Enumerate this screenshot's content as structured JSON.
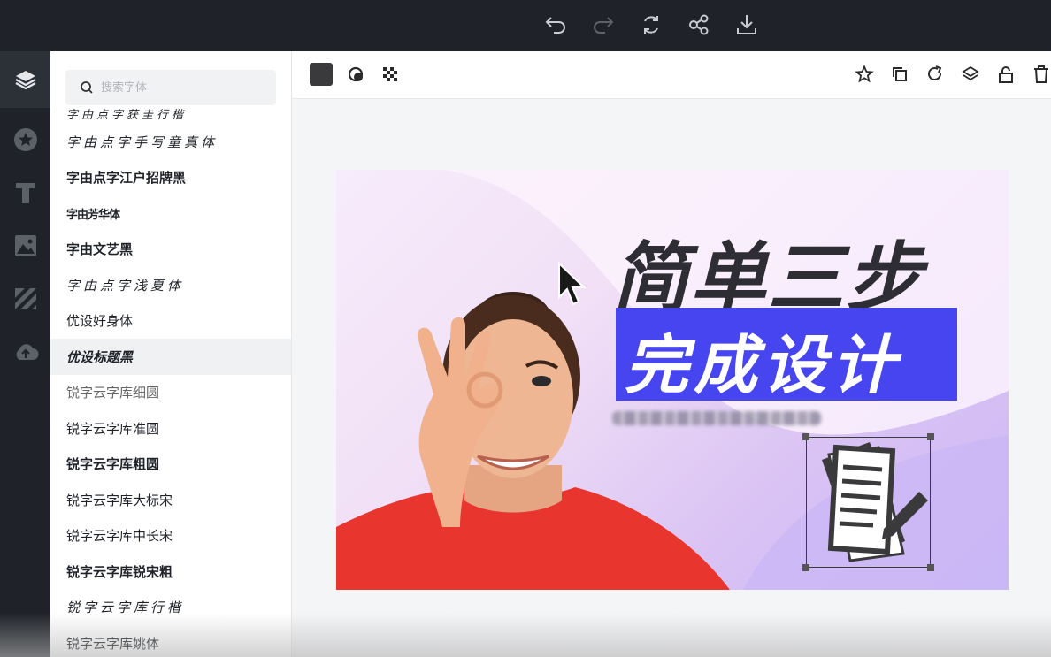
{
  "top_actions": [
    "undo-icon",
    "redo-icon",
    "refresh-icon",
    "share-icon",
    "download-icon"
  ],
  "rail": [
    "layers-icon",
    "star-icon",
    "text-icon",
    "image-icon",
    "background-icon",
    "upload-icon"
  ],
  "search": {
    "placeholder": "搜索字体"
  },
  "fonts": [
    {
      "label": "字由点字获圭行楷",
      "style": "partial"
    },
    {
      "label": "字由点字手写童真体",
      "style": "script"
    },
    {
      "label": "字由点字江户招牌黑",
      "style": "bold"
    },
    {
      "label": "字由芳华体",
      "style": "small"
    },
    {
      "label": "字由文艺黑",
      "style": "bold"
    },
    {
      "label": "字由点字浅夏体",
      "style": "script"
    },
    {
      "label": "优设好身体",
      "style": "plain"
    },
    {
      "label": "优设标题黑",
      "style": "italicbold",
      "highlighted": true
    },
    {
      "label": "锐字云字库细圆",
      "style": "light"
    },
    {
      "label": "锐字云字库准圆",
      "style": "plain"
    },
    {
      "label": "锐字云字库粗圆",
      "style": "bold"
    },
    {
      "label": "锐字云字库大标宋",
      "style": "serif"
    },
    {
      "label": "锐字云字库中长宋",
      "style": "serif"
    },
    {
      "label": "锐字云字库锐宋粗",
      "style": "bold"
    },
    {
      "label": "锐字云字库行楷",
      "style": "script"
    },
    {
      "label": "锐字云字库姚体",
      "style": "plain"
    }
  ],
  "toolbar": {
    "left": [
      "color-swatch",
      "shape-icon",
      "transparency-icon"
    ],
    "right": [
      "favorite-icon",
      "copy-icon",
      "rotate-icon",
      "layer-icon",
      "lock-icon",
      "delete-icon"
    ],
    "swatch_color": "#3a3a3c"
  },
  "canvas": {
    "headline": "简单三步",
    "subline": "完成设计",
    "accent": "#4645ef",
    "shirt_color": "#e8362f"
  }
}
